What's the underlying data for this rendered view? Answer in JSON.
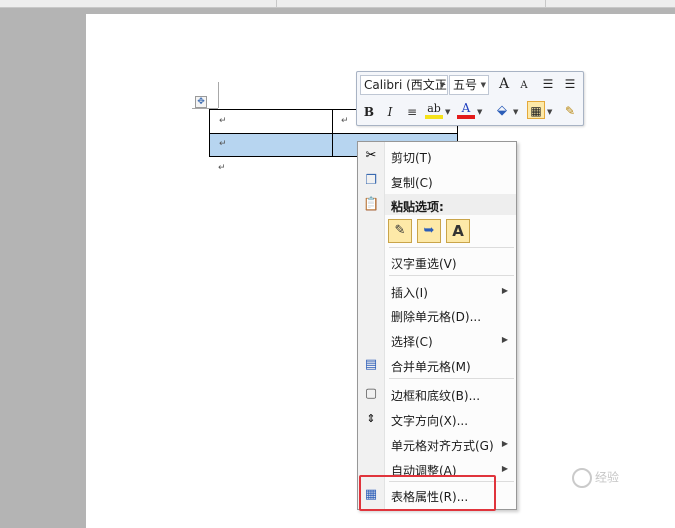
{
  "mini_toolbar": {
    "font_name": "Calibri (西文正文)",
    "font_size": "五号",
    "grow_font": "A",
    "shrink_font": "A",
    "bold": "B",
    "italic": "I",
    "font_color_letter": "A"
  },
  "table": {
    "end_mark": "↵"
  },
  "context_menu": {
    "cut": "剪切(T)",
    "copy": "复制(C)",
    "paste_options": "粘贴选项:",
    "paste_text_only": "A",
    "reconvert": "汉字重选(V)",
    "insert": "插入(I)",
    "delete_cells": "删除单元格(D)...",
    "select": "选择(C)",
    "merge_cells": "合并单元格(M)",
    "borders_shading": "边框和底纹(B)...",
    "text_direction": "文字方向(X)...",
    "cell_alignment": "单元格对齐方式(G)",
    "autofit": "自动调整(A)",
    "table_properties": "表格属性(R)..."
  },
  "watermark": "经验",
  "colors": {
    "selection": "#b7d5f0",
    "highlight_box": "#e0343c"
  }
}
